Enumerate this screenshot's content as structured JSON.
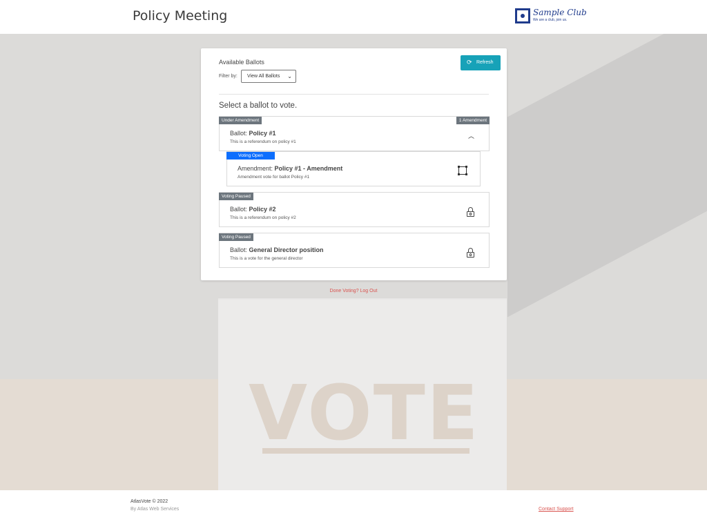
{
  "header": {
    "title": "Policy Meeting",
    "logo_name": "Sample Club",
    "logo_tagline": "We are a club, join us."
  },
  "background": {
    "box_text": "VOTE"
  },
  "card": {
    "heading": "Available Ballots",
    "filter_label": "Filter by:",
    "filter_value": "View All Ballots",
    "refresh_label": "Refresh",
    "select_title": "Select a ballot to vote."
  },
  "ballots": [
    {
      "status": "Under Amendment",
      "amendment_count": "1 Amendment",
      "prefix": "Ballot: ",
      "name": "Policy #1",
      "description": "This is a referendum on policy #1"
    },
    {
      "status": "Voting Paused",
      "prefix": "Ballot: ",
      "name": "Policy #2",
      "description": "This is a referendum on policy #2"
    },
    {
      "status": "Voting Paused",
      "prefix": "Ballot: ",
      "name": "General Director position",
      "description": "This is a vote for the general director"
    }
  ],
  "amendment": {
    "status": "Voting Open",
    "prefix": "Amendment: ",
    "name": "Policy #1 - Amendment",
    "description": "Amendment vote for ballot Policy #1"
  },
  "logout_text": "Done Voting? Log Out",
  "footer": {
    "copyright": "AtlasVote © 2022",
    "by": "By Atlas Web Services",
    "support": "Contact Support"
  },
  "colors": {
    "refresh_button": "#17a2b8",
    "badge_grey": "#6c757d",
    "badge_blue": "#0d6efd",
    "logout_link": "#d9534f",
    "logo_blue": "#1f3b8c"
  }
}
